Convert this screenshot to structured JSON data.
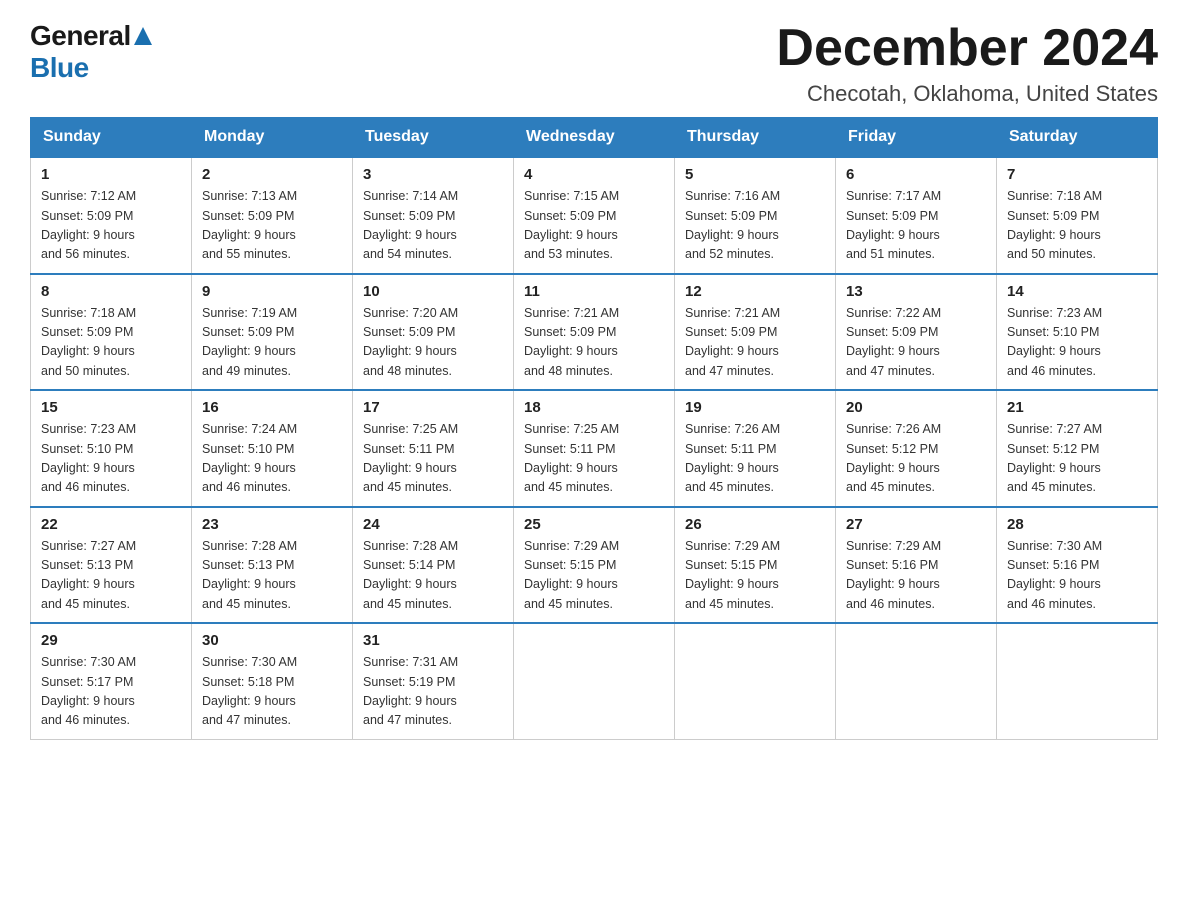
{
  "logo": {
    "general": "General",
    "blue": "Blue"
  },
  "title": "December 2024",
  "location": "Checotah, Oklahoma, United States",
  "days_of_week": [
    "Sunday",
    "Monday",
    "Tuesday",
    "Wednesday",
    "Thursday",
    "Friday",
    "Saturday"
  ],
  "weeks": [
    [
      {
        "day": "1",
        "sunrise": "7:12 AM",
        "sunset": "5:09 PM",
        "daylight": "9 hours and 56 minutes."
      },
      {
        "day": "2",
        "sunrise": "7:13 AM",
        "sunset": "5:09 PM",
        "daylight": "9 hours and 55 minutes."
      },
      {
        "day": "3",
        "sunrise": "7:14 AM",
        "sunset": "5:09 PM",
        "daylight": "9 hours and 54 minutes."
      },
      {
        "day": "4",
        "sunrise": "7:15 AM",
        "sunset": "5:09 PM",
        "daylight": "9 hours and 53 minutes."
      },
      {
        "day": "5",
        "sunrise": "7:16 AM",
        "sunset": "5:09 PM",
        "daylight": "9 hours and 52 minutes."
      },
      {
        "day": "6",
        "sunrise": "7:17 AM",
        "sunset": "5:09 PM",
        "daylight": "9 hours and 51 minutes."
      },
      {
        "day": "7",
        "sunrise": "7:18 AM",
        "sunset": "5:09 PM",
        "daylight": "9 hours and 50 minutes."
      }
    ],
    [
      {
        "day": "8",
        "sunrise": "7:18 AM",
        "sunset": "5:09 PM",
        "daylight": "9 hours and 50 minutes."
      },
      {
        "day": "9",
        "sunrise": "7:19 AM",
        "sunset": "5:09 PM",
        "daylight": "9 hours and 49 minutes."
      },
      {
        "day": "10",
        "sunrise": "7:20 AM",
        "sunset": "5:09 PM",
        "daylight": "9 hours and 48 minutes."
      },
      {
        "day": "11",
        "sunrise": "7:21 AM",
        "sunset": "5:09 PM",
        "daylight": "9 hours and 48 minutes."
      },
      {
        "day": "12",
        "sunrise": "7:21 AM",
        "sunset": "5:09 PM",
        "daylight": "9 hours and 47 minutes."
      },
      {
        "day": "13",
        "sunrise": "7:22 AM",
        "sunset": "5:09 PM",
        "daylight": "9 hours and 47 minutes."
      },
      {
        "day": "14",
        "sunrise": "7:23 AM",
        "sunset": "5:10 PM",
        "daylight": "9 hours and 46 minutes."
      }
    ],
    [
      {
        "day": "15",
        "sunrise": "7:23 AM",
        "sunset": "5:10 PM",
        "daylight": "9 hours and 46 minutes."
      },
      {
        "day": "16",
        "sunrise": "7:24 AM",
        "sunset": "5:10 PM",
        "daylight": "9 hours and 46 minutes."
      },
      {
        "day": "17",
        "sunrise": "7:25 AM",
        "sunset": "5:11 PM",
        "daylight": "9 hours and 45 minutes."
      },
      {
        "day": "18",
        "sunrise": "7:25 AM",
        "sunset": "5:11 PM",
        "daylight": "9 hours and 45 minutes."
      },
      {
        "day": "19",
        "sunrise": "7:26 AM",
        "sunset": "5:11 PM",
        "daylight": "9 hours and 45 minutes."
      },
      {
        "day": "20",
        "sunrise": "7:26 AM",
        "sunset": "5:12 PM",
        "daylight": "9 hours and 45 minutes."
      },
      {
        "day": "21",
        "sunrise": "7:27 AM",
        "sunset": "5:12 PM",
        "daylight": "9 hours and 45 minutes."
      }
    ],
    [
      {
        "day": "22",
        "sunrise": "7:27 AM",
        "sunset": "5:13 PM",
        "daylight": "9 hours and 45 minutes."
      },
      {
        "day": "23",
        "sunrise": "7:28 AM",
        "sunset": "5:13 PM",
        "daylight": "9 hours and 45 minutes."
      },
      {
        "day": "24",
        "sunrise": "7:28 AM",
        "sunset": "5:14 PM",
        "daylight": "9 hours and 45 minutes."
      },
      {
        "day": "25",
        "sunrise": "7:29 AM",
        "sunset": "5:15 PM",
        "daylight": "9 hours and 45 minutes."
      },
      {
        "day": "26",
        "sunrise": "7:29 AM",
        "sunset": "5:15 PM",
        "daylight": "9 hours and 45 minutes."
      },
      {
        "day": "27",
        "sunrise": "7:29 AM",
        "sunset": "5:16 PM",
        "daylight": "9 hours and 46 minutes."
      },
      {
        "day": "28",
        "sunrise": "7:30 AM",
        "sunset": "5:16 PM",
        "daylight": "9 hours and 46 minutes."
      }
    ],
    [
      {
        "day": "29",
        "sunrise": "7:30 AM",
        "sunset": "5:17 PM",
        "daylight": "9 hours and 46 minutes."
      },
      {
        "day": "30",
        "sunrise": "7:30 AM",
        "sunset": "5:18 PM",
        "daylight": "9 hours and 47 minutes."
      },
      {
        "day": "31",
        "sunrise": "7:31 AM",
        "sunset": "5:19 PM",
        "daylight": "9 hours and 47 minutes."
      },
      null,
      null,
      null,
      null
    ]
  ],
  "labels": {
    "sunrise": "Sunrise:",
    "sunset": "Sunset:",
    "daylight": "Daylight:"
  }
}
